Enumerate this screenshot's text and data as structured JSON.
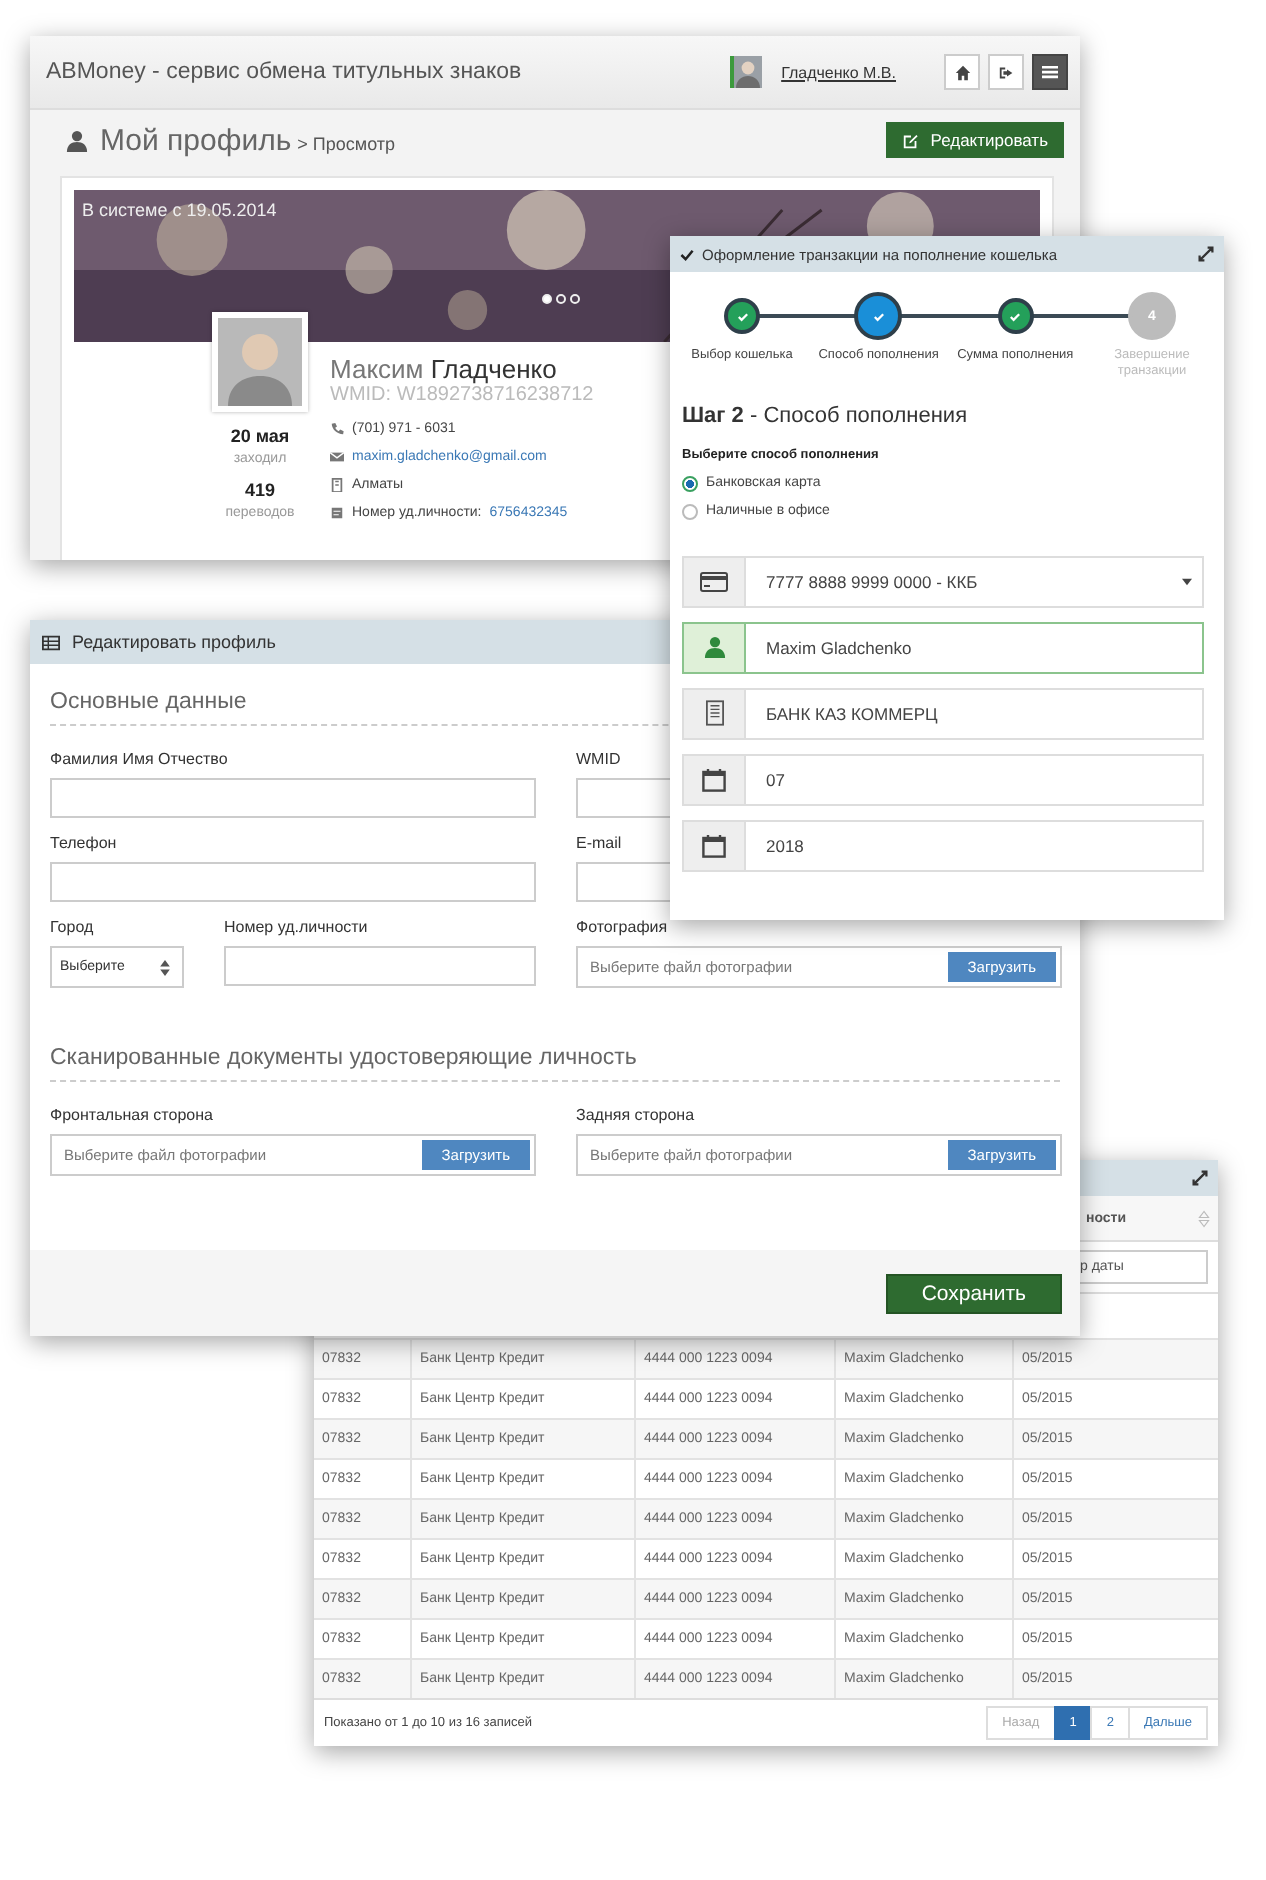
{
  "profile_window": {
    "brand": "ABMoney - сервис обмена титульных знаков",
    "user": "Гладченко М.В.",
    "page_title": "Мой профиль",
    "breadcrumb": "> Просмотр",
    "edit_button": "Редактировать",
    "banner_text": "В системе с 19.05.2014",
    "carousel_dots": [
      {
        "selected": true
      },
      {
        "selected": false
      },
      {
        "selected": false
      }
    ],
    "name_first": "Максим",
    "name_last": "Гладченко",
    "wmid": "WMID: W1892738716238712",
    "stats": [
      {
        "value": "20 мая",
        "label": "заходил"
      },
      {
        "value": "419",
        "label": "переводов"
      }
    ],
    "contacts": [
      {
        "kind": "phone",
        "text": "(701) 971 - 6031"
      },
      {
        "kind": "email",
        "text": "maxim.gladchenko@gmail.com"
      },
      {
        "kind": "city",
        "text": "Алматы"
      },
      {
        "kind": "id",
        "label": "Номер уд.личности:",
        "text": "6756432345"
      }
    ]
  },
  "table_window": {
    "last_column_header": "ности",
    "date_filter": {
      "placeholder": "р даты"
    },
    "rows": [
      [
        "07832",
        "Банк Центр Кредит",
        "4444 000 1223 0094",
        "Maxim Gladchenko",
        "05/2015"
      ],
      [
        "07832",
        "Банк Центр Кредит",
        "4444 000 1223 0094",
        "Maxim Gladchenko",
        "05/2015"
      ],
      [
        "07832",
        "Банк Центр Кредит",
        "4444 000 1223 0094",
        "Maxim Gladchenko",
        "05/2015"
      ],
      [
        "07832",
        "Банк Центр Кредит",
        "4444 000 1223 0094",
        "Maxim Gladchenko",
        "05/2015"
      ],
      [
        "07832",
        "Банк Центр Кредит",
        "4444 000 1223 0094",
        "Maxim Gladchenko",
        "05/2015"
      ],
      [
        "07832",
        "Банк Центр Кредит",
        "4444 000 1223 0094",
        "Maxim Gladchenko",
        "05/2015"
      ],
      [
        "07832",
        "Банк Центр Кредит",
        "4444 000 1223 0094",
        "Maxim Gladchenko",
        "05/2015"
      ],
      [
        "07832",
        "Банк Центр Кредит",
        "4444 000 1223 0094",
        "Maxim Gladchenko",
        "05/2015"
      ],
      [
        "07832",
        "Банк Центр Кредит",
        "4444 000 1223 0094",
        "Maxim Gladchenko",
        "05/2015"
      ]
    ],
    "footer": "Показано от 1 до 10 из 16 записей",
    "pagination": {
      "prev": {
        "label": "Назад",
        "disabled": true
      },
      "pages": [
        {
          "label": "1",
          "selected": true
        },
        {
          "label": "2",
          "selected": false
        }
      ],
      "next": {
        "label": "Дальше",
        "disabled": false
      }
    }
  },
  "edit_window": {
    "title": "Редактировать профиль",
    "section_1": "Основные данные",
    "full_name": {
      "label": "Фамилия Имя Отчество"
    },
    "wmid": {
      "label": "WMID"
    },
    "phone": {
      "label": "Телефон"
    },
    "email": {
      "label": "E-mail"
    },
    "city": {
      "label": "Город",
      "value": "Выберите"
    },
    "id_number": {
      "label": "Номер уд.личности"
    },
    "photo": {
      "label": "Фотография",
      "placeholder": "Выберите файл фотографии",
      "button": "Загрузить"
    },
    "section_2": "Сканированные документы удостоверяющие личность",
    "front": {
      "label": "Фронтальная сторона",
      "placeholder": "Выберите файл фотографии",
      "button": "Загрузить"
    },
    "back": {
      "label": "Задняя сторона",
      "placeholder": "Выберите файл фотографии",
      "button": "Загрузить"
    },
    "save_button": "Сохранить"
  },
  "wizard": {
    "title": "Оформление транзакции на пополнение кошелька",
    "steps": [
      {
        "label": "Выбор кошелька",
        "kind": "done"
      },
      {
        "label": "Способ пополнения",
        "kind": "current"
      },
      {
        "label": "Сумма пополнения",
        "kind": "done"
      },
      {
        "number": "4",
        "label": "Завершение транзакции",
        "kind": "pending"
      }
    ],
    "heading": "**Шаг 2** - Способ пополнения",
    "method_label": "Выберите способ пополнения",
    "methods": [
      {
        "label": "Банковская карта",
        "selected": true
      },
      {
        "label": "Наличные в офисе",
        "selected": false
      }
    ],
    "fields": [
      {
        "kind": "card",
        "value": "7777 8888 9999 0000 - ККБ",
        "dropdown": true,
        "valid": false
      },
      {
        "kind": "person",
        "value": "Maxim Gladchenko",
        "dropdown": false,
        "valid": true
      },
      {
        "kind": "bank",
        "value": "БАНК КАЗ КОММЕРЦ",
        "dropdown": false,
        "valid": false
      },
      {
        "kind": "calendar",
        "value": "07",
        "dropdown": false,
        "valid": false
      },
      {
        "kind": "calendar",
        "value": "2018",
        "dropdown": false,
        "valid": false
      }
    ]
  }
}
